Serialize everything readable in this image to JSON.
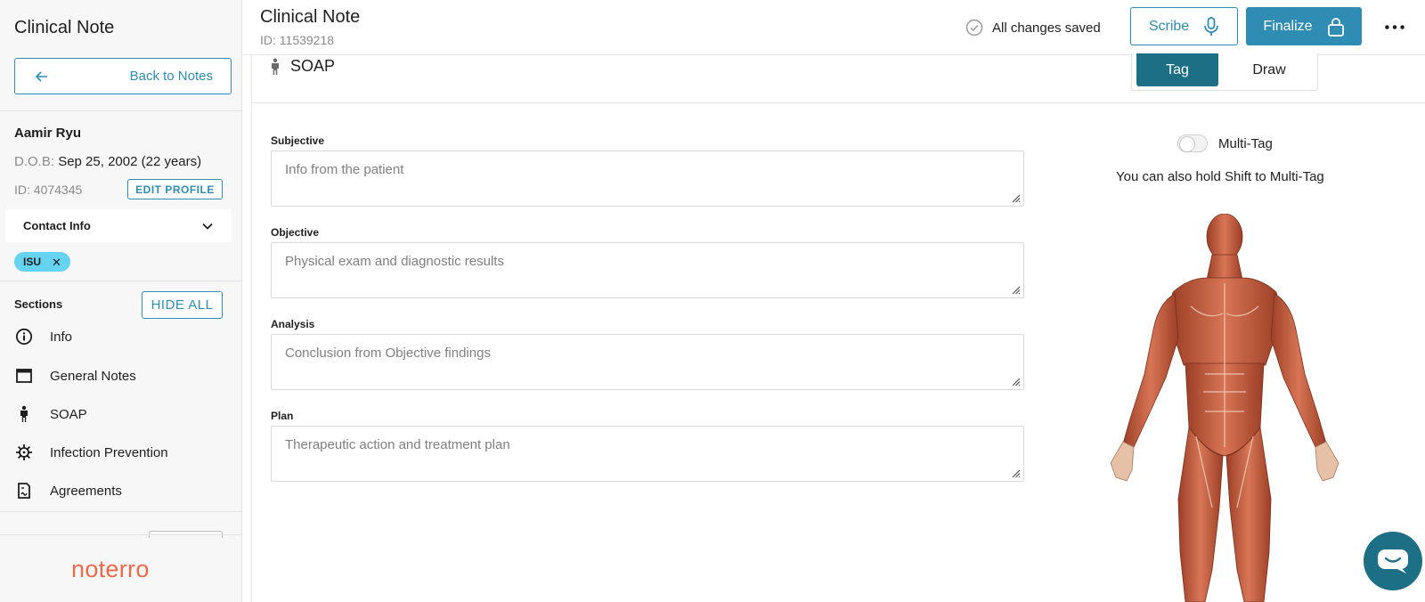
{
  "sidebar": {
    "title": "Clinical Note",
    "back_label": "Back to Notes",
    "patient": {
      "name": "Aamir Ryu",
      "dob_label": "D.O.B:",
      "dob_value": "Sep 25, 2002 (22 years)",
      "id_text": "ID: 4074345",
      "edit_label": "EDIT PROFILE"
    },
    "contact_label": "Contact Info",
    "tag_chip": "ISU",
    "sections_label": "Sections",
    "hide_all_label": "HIDE ALL",
    "items": [
      {
        "label": "Info",
        "icon": "info-icon"
      },
      {
        "label": "General Notes",
        "icon": "window-icon"
      },
      {
        "label": "SOAP",
        "icon": "person-icon"
      },
      {
        "label": "Infection Prevention",
        "icon": "virus-icon"
      },
      {
        "label": "Agreements",
        "icon": "document-icon"
      }
    ],
    "logo": "noterro"
  },
  "header": {
    "title": "Clinical Note",
    "id_text": "ID: 11539218",
    "saved_text": "All changes saved",
    "scribe_label": "Scribe",
    "finalize_label": "Finalize"
  },
  "soap": {
    "title": "SOAP",
    "mode_tag": "Tag",
    "mode_draw": "Draw",
    "fields": [
      {
        "label": "Subjective",
        "placeholder": "Info from the patient"
      },
      {
        "label": "Objective",
        "placeholder": "Physical exam and diagnostic results"
      },
      {
        "label": "Analysis",
        "placeholder": "Conclusion from Objective findings"
      },
      {
        "label": "Plan",
        "placeholder": "Therapeutic action and treatment plan"
      }
    ],
    "multitag_label": "Multi-Tag",
    "multitag_on": false,
    "hint": "You can also hold Shift to Multi-Tag"
  },
  "colors": {
    "primary": "#2f8cb2",
    "dark_teal": "#1c6f85",
    "chip": "#66d3f0",
    "logo": "#ee6a4c",
    "muscle": "#c45a3c"
  }
}
